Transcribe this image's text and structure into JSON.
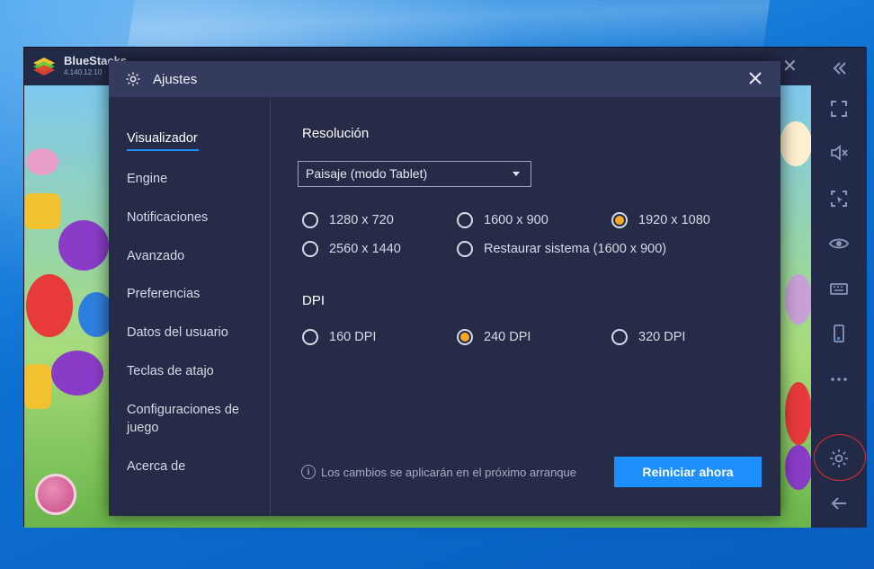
{
  "app": {
    "name": "BlueStacks",
    "version": "4.140.12.10"
  },
  "dialog": {
    "title": "Ajustes"
  },
  "nav": {
    "items": [
      {
        "label": "Visualizador",
        "active": true
      },
      {
        "label": "Engine"
      },
      {
        "label": "Notificaciones"
      },
      {
        "label": "Avanzado"
      },
      {
        "label": "Preferencias"
      },
      {
        "label": "Datos del usuario"
      },
      {
        "label": "Teclas de atajo"
      },
      {
        "label": "Configuraciones de juego"
      },
      {
        "label": "Acerca de"
      }
    ]
  },
  "resolution": {
    "title": "Resolución",
    "mode_selected": "Paisaje (modo Tablet)",
    "options": [
      {
        "label": "1280 x 720",
        "selected": false
      },
      {
        "label": "1600 x 900",
        "selected": false
      },
      {
        "label": "1920 x 1080",
        "selected": true
      },
      {
        "label": "2560 x 1440",
        "selected": false
      },
      {
        "label": "Restaurar sistema (1600 x 900)",
        "selected": false
      }
    ]
  },
  "dpi": {
    "title": "DPI",
    "options": [
      {
        "label": "160 DPI",
        "selected": false
      },
      {
        "label": "240 DPI",
        "selected": true
      },
      {
        "label": "320 DPI",
        "selected": false
      }
    ]
  },
  "footer": {
    "notice": "Los cambios se aplicarán en el próximo arranque",
    "restart_label": "Reiniciar ahora"
  },
  "colors": {
    "accent": "#1e8fff",
    "radio_selected": "#f5a623",
    "annotation_circle": "#e0302a"
  }
}
